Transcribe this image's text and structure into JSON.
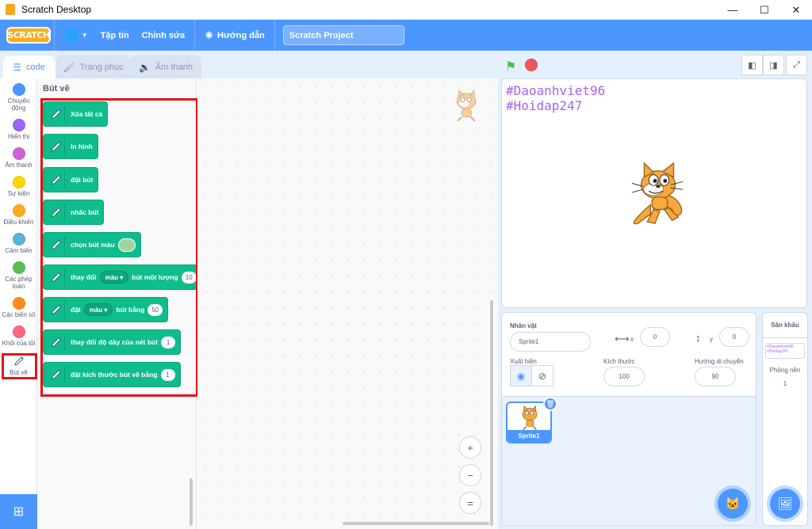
{
  "window": {
    "title": "Scratch Desktop",
    "minimize": "—",
    "maximize": "☐",
    "close": "✕"
  },
  "menubar": {
    "logo": "SCRATCH",
    "language_icon": "globe-icon",
    "file": "Tập tin",
    "edit": "Chỉnh sửa",
    "tutorials": "Hướng dẫn",
    "project_title": "Scratch Project"
  },
  "tabs": [
    {
      "label": "code",
      "icon": "code-icon"
    },
    {
      "label": "Trang phục",
      "icon": "brush-icon"
    },
    {
      "label": "Âm thanh",
      "icon": "speaker-icon"
    }
  ],
  "categories": [
    {
      "label": "Chuyển động",
      "color": "#4c97ff"
    },
    {
      "label": "Hiển thị",
      "color": "#9966ff"
    },
    {
      "label": "Âm thanh",
      "color": "#cf63cf"
    },
    {
      "label": "Sự kiện",
      "color": "#ffd500"
    },
    {
      "label": "Điều khiển",
      "color": "#ffab19"
    },
    {
      "label": "Cảm biến",
      "color": "#5cb1d6"
    },
    {
      "label": "Các phép toán",
      "color": "#59c059"
    },
    {
      "label": "Các biến số",
      "color": "#ff8c1a"
    },
    {
      "label": "Khối của tôi",
      "color": "#ff6680"
    },
    {
      "label": "Bút vẽ",
      "color": "#0fbd8c"
    }
  ],
  "palette": {
    "heading": "Bút vẽ",
    "blocks": {
      "clear": "Xóa tất cả",
      "stamp": "in hình",
      "pen_down": "đặt bút",
      "pen_up": "nhấc bút",
      "set_color": "chọn bút màu",
      "change_prefix": "thay đổi",
      "change_dropdown": "màu ▾",
      "change_suffix": "bút một lượng",
      "change_value": "10",
      "set_prefix": "đặt",
      "set_dropdown": "màu ▾",
      "set_suffix": "bút bằng",
      "set_value": "50",
      "change_size": "thay đổi độ dày của nét bút",
      "change_size_value": "1",
      "set_size": "đặt kích thước bút vẽ bằng",
      "set_size_value": "1"
    }
  },
  "zoom": {
    "in": "+",
    "out": "−",
    "reset": "="
  },
  "stage": {
    "text_line1": "#Daoanhviet96",
    "text_line2": "#Hoidap247"
  },
  "sprite_info": {
    "sprite_label": "Nhân vật",
    "sprite_name": "Sprite1",
    "x_label": "x",
    "x_value": "0",
    "y_label": "y",
    "y_value": "0",
    "show_label": "Xuất hiện",
    "size_label": "Kích thước",
    "size_value": "100",
    "direction_label": "Hướng di chuyển",
    "direction_value": "90"
  },
  "sprite_list": [
    {
      "name": "Sprite1"
    }
  ],
  "stage_panel": {
    "title": "Sân khấu",
    "backdrops_label": "Phông nền",
    "backdrops_count": "1",
    "thumb_line1": "#Daoanhviet96",
    "thumb_line2": "#Hoidap247"
  }
}
